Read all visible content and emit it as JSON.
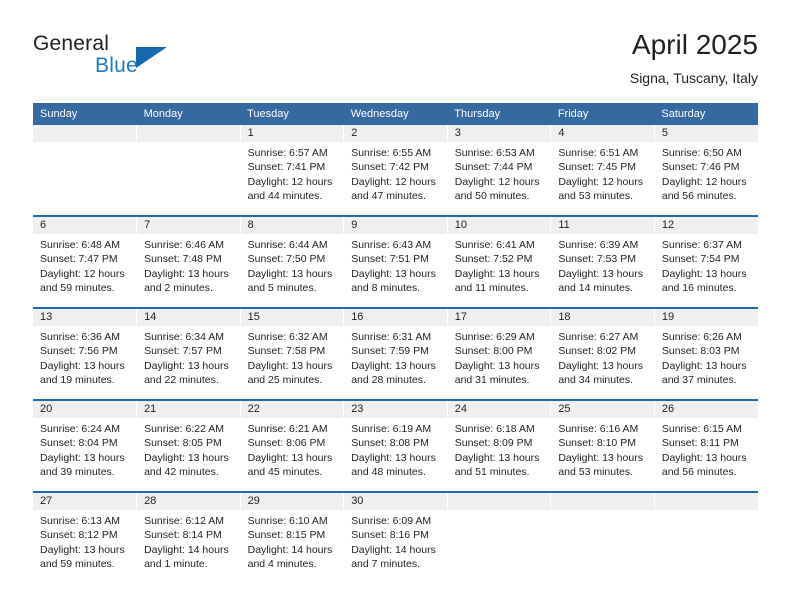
{
  "brand": {
    "name_part1": "General",
    "name_part2": "Blue",
    "logo_icon": "triangle-flag-icon"
  },
  "header": {
    "title": "April 2025",
    "subtitle": "Signa, Tuscany, Italy"
  },
  "theme": {
    "header_blue": "#36699f",
    "row_border_blue": "#1f6cb0",
    "daynum_band": "#efefef",
    "brand_blue": "#1f7ac4",
    "text": "#231f20"
  },
  "weekday_headers": [
    "Sunday",
    "Monday",
    "Tuesday",
    "Wednesday",
    "Thursday",
    "Friday",
    "Saturday"
  ],
  "weeks": [
    [
      {
        "day": "",
        "sunrise": "",
        "sunset": "",
        "daylight_line1": "",
        "daylight_line2": "",
        "empty": true
      },
      {
        "day": "",
        "sunrise": "",
        "sunset": "",
        "daylight_line1": "",
        "daylight_line2": "",
        "empty": true
      },
      {
        "day": "1",
        "sunrise": "Sunrise: 6:57 AM",
        "sunset": "Sunset: 7:41 PM",
        "daylight_line1": "Daylight: 12 hours",
        "daylight_line2": "and 44 minutes."
      },
      {
        "day": "2",
        "sunrise": "Sunrise: 6:55 AM",
        "sunset": "Sunset: 7:42 PM",
        "daylight_line1": "Daylight: 12 hours",
        "daylight_line2": "and 47 minutes."
      },
      {
        "day": "3",
        "sunrise": "Sunrise: 6:53 AM",
        "sunset": "Sunset: 7:44 PM",
        "daylight_line1": "Daylight: 12 hours",
        "daylight_line2": "and 50 minutes."
      },
      {
        "day": "4",
        "sunrise": "Sunrise: 6:51 AM",
        "sunset": "Sunset: 7:45 PM",
        "daylight_line1": "Daylight: 12 hours",
        "daylight_line2": "and 53 minutes."
      },
      {
        "day": "5",
        "sunrise": "Sunrise: 6:50 AM",
        "sunset": "Sunset: 7:46 PM",
        "daylight_line1": "Daylight: 12 hours",
        "daylight_line2": "and 56 minutes."
      }
    ],
    [
      {
        "day": "6",
        "sunrise": "Sunrise: 6:48 AM",
        "sunset": "Sunset: 7:47 PM",
        "daylight_line1": "Daylight: 12 hours",
        "daylight_line2": "and 59 minutes."
      },
      {
        "day": "7",
        "sunrise": "Sunrise: 6:46 AM",
        "sunset": "Sunset: 7:48 PM",
        "daylight_line1": "Daylight: 13 hours",
        "daylight_line2": "and 2 minutes."
      },
      {
        "day": "8",
        "sunrise": "Sunrise: 6:44 AM",
        "sunset": "Sunset: 7:50 PM",
        "daylight_line1": "Daylight: 13 hours",
        "daylight_line2": "and 5 minutes."
      },
      {
        "day": "9",
        "sunrise": "Sunrise: 6:43 AM",
        "sunset": "Sunset: 7:51 PM",
        "daylight_line1": "Daylight: 13 hours",
        "daylight_line2": "and 8 minutes."
      },
      {
        "day": "10",
        "sunrise": "Sunrise: 6:41 AM",
        "sunset": "Sunset: 7:52 PM",
        "daylight_line1": "Daylight: 13 hours",
        "daylight_line2": "and 11 minutes."
      },
      {
        "day": "11",
        "sunrise": "Sunrise: 6:39 AM",
        "sunset": "Sunset: 7:53 PM",
        "daylight_line1": "Daylight: 13 hours",
        "daylight_line2": "and 14 minutes."
      },
      {
        "day": "12",
        "sunrise": "Sunrise: 6:37 AM",
        "sunset": "Sunset: 7:54 PM",
        "daylight_line1": "Daylight: 13 hours",
        "daylight_line2": "and 16 minutes."
      }
    ],
    [
      {
        "day": "13",
        "sunrise": "Sunrise: 6:36 AM",
        "sunset": "Sunset: 7:56 PM",
        "daylight_line1": "Daylight: 13 hours",
        "daylight_line2": "and 19 minutes."
      },
      {
        "day": "14",
        "sunrise": "Sunrise: 6:34 AM",
        "sunset": "Sunset: 7:57 PM",
        "daylight_line1": "Daylight: 13 hours",
        "daylight_line2": "and 22 minutes."
      },
      {
        "day": "15",
        "sunrise": "Sunrise: 6:32 AM",
        "sunset": "Sunset: 7:58 PM",
        "daylight_line1": "Daylight: 13 hours",
        "daylight_line2": "and 25 minutes."
      },
      {
        "day": "16",
        "sunrise": "Sunrise: 6:31 AM",
        "sunset": "Sunset: 7:59 PM",
        "daylight_line1": "Daylight: 13 hours",
        "daylight_line2": "and 28 minutes."
      },
      {
        "day": "17",
        "sunrise": "Sunrise: 6:29 AM",
        "sunset": "Sunset: 8:00 PM",
        "daylight_line1": "Daylight: 13 hours",
        "daylight_line2": "and 31 minutes."
      },
      {
        "day": "18",
        "sunrise": "Sunrise: 6:27 AM",
        "sunset": "Sunset: 8:02 PM",
        "daylight_line1": "Daylight: 13 hours",
        "daylight_line2": "and 34 minutes."
      },
      {
        "day": "19",
        "sunrise": "Sunrise: 6:26 AM",
        "sunset": "Sunset: 8:03 PM",
        "daylight_line1": "Daylight: 13 hours",
        "daylight_line2": "and 37 minutes."
      }
    ],
    [
      {
        "day": "20",
        "sunrise": "Sunrise: 6:24 AM",
        "sunset": "Sunset: 8:04 PM",
        "daylight_line1": "Daylight: 13 hours",
        "daylight_line2": "and 39 minutes."
      },
      {
        "day": "21",
        "sunrise": "Sunrise: 6:22 AM",
        "sunset": "Sunset: 8:05 PM",
        "daylight_line1": "Daylight: 13 hours",
        "daylight_line2": "and 42 minutes."
      },
      {
        "day": "22",
        "sunrise": "Sunrise: 6:21 AM",
        "sunset": "Sunset: 8:06 PM",
        "daylight_line1": "Daylight: 13 hours",
        "daylight_line2": "and 45 minutes."
      },
      {
        "day": "23",
        "sunrise": "Sunrise: 6:19 AM",
        "sunset": "Sunset: 8:08 PM",
        "daylight_line1": "Daylight: 13 hours",
        "daylight_line2": "and 48 minutes."
      },
      {
        "day": "24",
        "sunrise": "Sunrise: 6:18 AM",
        "sunset": "Sunset: 8:09 PM",
        "daylight_line1": "Daylight: 13 hours",
        "daylight_line2": "and 51 minutes."
      },
      {
        "day": "25",
        "sunrise": "Sunrise: 6:16 AM",
        "sunset": "Sunset: 8:10 PM",
        "daylight_line1": "Daylight: 13 hours",
        "daylight_line2": "and 53 minutes."
      },
      {
        "day": "26",
        "sunrise": "Sunrise: 6:15 AM",
        "sunset": "Sunset: 8:11 PM",
        "daylight_line1": "Daylight: 13 hours",
        "daylight_line2": "and 56 minutes."
      }
    ],
    [
      {
        "day": "27",
        "sunrise": "Sunrise: 6:13 AM",
        "sunset": "Sunset: 8:12 PM",
        "daylight_line1": "Daylight: 13 hours",
        "daylight_line2": "and 59 minutes."
      },
      {
        "day": "28",
        "sunrise": "Sunrise: 6:12 AM",
        "sunset": "Sunset: 8:14 PM",
        "daylight_line1": "Daylight: 14 hours",
        "daylight_line2": "and 1 minute."
      },
      {
        "day": "29",
        "sunrise": "Sunrise: 6:10 AM",
        "sunset": "Sunset: 8:15 PM",
        "daylight_line1": "Daylight: 14 hours",
        "daylight_line2": "and 4 minutes."
      },
      {
        "day": "30",
        "sunrise": "Sunrise: 6:09 AM",
        "sunset": "Sunset: 8:16 PM",
        "daylight_line1": "Daylight: 14 hours",
        "daylight_line2": "and 7 minutes."
      },
      {
        "day": "",
        "sunrise": "",
        "sunset": "",
        "daylight_line1": "",
        "daylight_line2": "",
        "empty": true
      },
      {
        "day": "",
        "sunrise": "",
        "sunset": "",
        "daylight_line1": "",
        "daylight_line2": "",
        "empty": true
      },
      {
        "day": "",
        "sunrise": "",
        "sunset": "",
        "daylight_line1": "",
        "daylight_line2": "",
        "empty": true
      }
    ]
  ]
}
